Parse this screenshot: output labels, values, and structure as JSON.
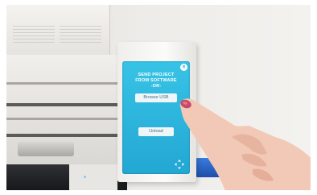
{
  "photo": {
    "subject_icon": "cutting-machine-touchscreen-photo"
  },
  "screen": {
    "title_line1": "SEND PROJECT",
    "title_line2": "FROM SOFTWARE",
    "title_line3": "-OR-",
    "browse_label": "Browse USB",
    "unload_label": "Unload",
    "accent_color": "#29b3dc"
  }
}
